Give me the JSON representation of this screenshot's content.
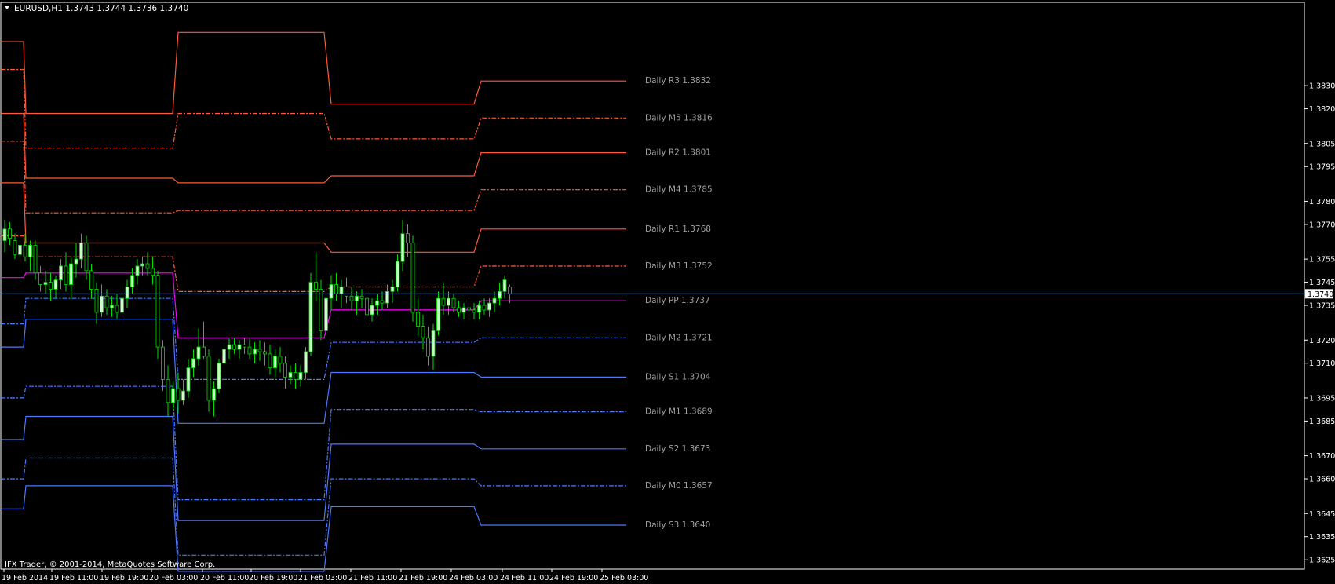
{
  "header": {
    "title": "EURUSD,H1  1.3743 1.3744 1.3736 1.3740"
  },
  "footer": {
    "copyright": "IFX Trader, © 2001-2014, MetaQuotes Software Corp."
  },
  "colors": {
    "background": "#000000",
    "frame": "#ffffff",
    "text": "#ffffff",
    "pivot_label": "#a0a0a0",
    "resistance": "#ff5a36",
    "pivot": "#ff00ff",
    "support": "#4b78ff",
    "candle_up": "#ccffcc",
    "candle_down": "#000000",
    "candle_wick": "#00e000",
    "current_price_line": "#7fa6c6"
  },
  "chart_data": {
    "type": "candlestick",
    "symbol": "EURUSD",
    "timeframe": "H1",
    "last_bar": {
      "open": 1.3743,
      "high": 1.3744,
      "low": 1.3736,
      "close": 1.374
    },
    "current_price": 1.374,
    "current_price_label": "1.3740",
    "ylim": [
      1.3621,
      1.3866
    ],
    "y_ticks": [
      "1.3830",
      "1.3820",
      "1.3805",
      "1.3795",
      "1.3780",
      "1.3770",
      "1.3755",
      "1.3745",
      "1.3735",
      "1.3720",
      "1.3710",
      "1.3695",
      "1.3685",
      "1.3670",
      "1.3660",
      "1.3645",
      "1.3635",
      "1.3625"
    ],
    "x_ticks": [
      "19 Feb 2014",
      "19 Feb 11:00",
      "19 Feb 19:00",
      "20 Feb 03:00",
      "20 Feb 11:00",
      "20 Feb 19:00",
      "21 Feb 03:00",
      "21 Feb 11:00",
      "21 Feb 19:00",
      "24 Feb 03:00",
      "24 Feb 11:00",
      "24 Feb 19:00",
      "25 Feb 03:00"
    ],
    "pivot_labels": [
      {
        "label": "Daily R3 1.3832",
        "level": 1.3832,
        "kind": "R"
      },
      {
        "label": "Daily M5 1.3816",
        "level": 1.3816,
        "kind": "M"
      },
      {
        "label": "Daily R2 1.3801",
        "level": 1.3801,
        "kind": "R"
      },
      {
        "label": "Daily M4 1.3785",
        "level": 1.3785,
        "kind": "M"
      },
      {
        "label": "Daily R1 1.3768",
        "level": 1.3768,
        "kind": "R"
      },
      {
        "label": "Daily M3 1.3752",
        "level": 1.3752,
        "kind": "M"
      },
      {
        "label": "Daily PP 1.3737",
        "level": 1.3737,
        "kind": "P"
      },
      {
        "label": "Daily M2 1.3721",
        "level": 1.3721,
        "kind": "M"
      },
      {
        "label": "Daily S1 1.3704",
        "level": 1.3704,
        "kind": "S"
      },
      {
        "label": "Daily M1 1.3689",
        "level": 1.3689,
        "kind": "M"
      },
      {
        "label": "Daily S2 1.3673",
        "level": 1.3673,
        "kind": "S"
      },
      {
        "label": "Daily M0 1.3657",
        "level": 1.3657,
        "kind": "M"
      },
      {
        "label": "Daily S3 1.3640",
        "level": 1.364,
        "kind": "S"
      }
    ],
    "daily_pivot_history": [
      {
        "R3": 1.3849,
        "M5": 1.3837,
        "R2": 1.3818,
        "M4": 1.3806,
        "R1": 1.3788,
        "M3": 1.3765,
        "PP": 1.3747,
        "M2": 1.3727,
        "S1": 1.3717,
        "M1": 1.3695,
        "S2": 1.3677,
        "M0": 1.366,
        "S3": 1.3647
      },
      {
        "R3": 1.3818,
        "M5": 1.3803,
        "R2": 1.379,
        "M4": 1.3775,
        "R1": 1.3762,
        "M3": 1.3756,
        "PP": 1.3749,
        "M2": 1.3738,
        "S1": 1.3729,
        "M1": 1.37,
        "S2": 1.3687,
        "M0": 1.3669,
        "S3": 1.3657
      },
      {
        "R3": 1.3853,
        "M5": 1.3818,
        "R2": 1.3788,
        "M4": 1.3776,
        "R1": 1.3762,
        "M3": 1.3741,
        "PP": 1.3721,
        "M2": 1.3703,
        "S1": 1.3684,
        "M1": 1.3651,
        "S2": 1.3642,
        "M0": 1.3627,
        "S3": 1.362
      },
      {
        "R3": 1.3822,
        "M5": 1.3807,
        "R2": 1.3791,
        "M4": 1.3776,
        "R1": 1.3758,
        "M3": 1.3743,
        "PP": 1.3733,
        "M2": 1.3719,
        "S1": 1.3706,
        "M1": 1.369,
        "S2": 1.3675,
        "M0": 1.366,
        "S3": 1.3648
      },
      {
        "R3": 1.3832,
        "M5": 1.3816,
        "R2": 1.3801,
        "M4": 1.3785,
        "R1": 1.3768,
        "M3": 1.3752,
        "PP": 1.3737,
        "M2": 1.3721,
        "S1": 1.3704,
        "M1": 1.3689,
        "S2": 1.3673,
        "M0": 1.3657,
        "S3": 1.364
      }
    ],
    "candles": [
      [
        1.3763,
        1.3772,
        1.3758,
        1.3768
      ],
      [
        1.3768,
        1.3771,
        1.3761,
        1.3764
      ],
      [
        1.3763,
        1.3766,
        1.3755,
        1.3757
      ],
      [
        1.3757,
        1.3763,
        1.3749,
        1.3761
      ],
      [
        1.3761,
        1.3766,
        1.3754,
        1.3756
      ],
      [
        1.3756,
        1.3763,
        1.375,
        1.3761
      ],
      [
        1.3761,
        1.3763,
        1.3746,
        1.3749
      ],
      [
        1.3749,
        1.3752,
        1.3741,
        1.3744
      ],
      [
        1.3744,
        1.375,
        1.374,
        1.3745
      ],
      [
        1.3745,
        1.3749,
        1.3737,
        1.3742
      ],
      [
        1.3742,
        1.3748,
        1.3738,
        1.3746
      ],
      [
        1.3746,
        1.3755,
        1.3742,
        1.3752
      ],
      [
        1.3752,
        1.3758,
        1.3741,
        1.3744
      ],
      [
        1.3744,
        1.3756,
        1.3738,
        1.3753
      ],
      [
        1.3753,
        1.3762,
        1.3747,
        1.3755
      ],
      [
        1.3755,
        1.3766,
        1.3751,
        1.3762
      ],
      [
        1.3762,
        1.3765,
        1.3746,
        1.375
      ],
      [
        1.375,
        1.3753,
        1.3738,
        1.3742
      ],
      [
        1.3742,
        1.3745,
        1.3727,
        1.3732
      ],
      [
        1.3732,
        1.3744,
        1.373,
        1.3739
      ],
      [
        1.3739,
        1.3742,
        1.3731,
        1.3734
      ],
      [
        1.3734,
        1.3739,
        1.373,
        1.3735
      ],
      [
        1.3735,
        1.374,
        1.3729,
        1.3732
      ],
      [
        1.3732,
        1.374,
        1.373,
        1.3738
      ],
      [
        1.3738,
        1.3746,
        1.3734,
        1.3743
      ],
      [
        1.3743,
        1.3751,
        1.374,
        1.3748
      ],
      [
        1.3748,
        1.3755,
        1.3744,
        1.3752
      ],
      [
        1.3752,
        1.3756,
        1.3748,
        1.3753
      ],
      [
        1.3753,
        1.3758,
        1.3748,
        1.3751
      ],
      [
        1.3751,
        1.3756,
        1.3744,
        1.3748
      ],
      [
        1.3748,
        1.375,
        1.3712,
        1.3717
      ],
      [
        1.3717,
        1.372,
        1.3698,
        1.3703
      ],
      [
        1.3703,
        1.3709,
        1.3687,
        1.3693
      ],
      [
        1.3693,
        1.3702,
        1.369,
        1.3699
      ],
      [
        1.3699,
        1.3706,
        1.3688,
        1.3694
      ],
      [
        1.3694,
        1.3703,
        1.3692,
        1.3698
      ],
      [
        1.3698,
        1.3712,
        1.3695,
        1.3708
      ],
      [
        1.3708,
        1.3716,
        1.3704,
        1.3712
      ],
      [
        1.3712,
        1.3725,
        1.3709,
        1.3717
      ],
      [
        1.3717,
        1.3728,
        1.3712,
        1.3713
      ],
      [
        1.3713,
        1.3716,
        1.3689,
        1.3694
      ],
      [
        1.3694,
        1.3702,
        1.3687,
        1.3699
      ],
      [
        1.3699,
        1.3712,
        1.3697,
        1.371
      ],
      [
        1.371,
        1.3719,
        1.3706,
        1.3716
      ],
      [
        1.3716,
        1.3721,
        1.3712,
        1.3718
      ],
      [
        1.3718,
        1.3721,
        1.3714,
        1.3716
      ],
      [
        1.3716,
        1.372,
        1.3712,
        1.3718
      ],
      [
        1.3718,
        1.3721,
        1.3714,
        1.3717
      ],
      [
        1.3717,
        1.3721,
        1.3712,
        1.3714
      ],
      [
        1.3714,
        1.3719,
        1.371,
        1.3716
      ],
      [
        1.3716,
        1.372,
        1.3711,
        1.3715
      ],
      [
        1.3715,
        1.3719,
        1.3709,
        1.3714
      ],
      [
        1.3714,
        1.3718,
        1.3705,
        1.3708
      ],
      [
        1.3708,
        1.3716,
        1.3704,
        1.3713
      ],
      [
        1.3713,
        1.3717,
        1.3706,
        1.371
      ],
      [
        1.371,
        1.3713,
        1.3699,
        1.3704
      ],
      [
        1.3704,
        1.3709,
        1.3701,
        1.3706
      ],
      [
        1.3706,
        1.371,
        1.3699,
        1.3703
      ],
      [
        1.3703,
        1.3709,
        1.37,
        1.3706
      ],
      [
        1.3706,
        1.3717,
        1.3703,
        1.3715
      ],
      [
        1.3715,
        1.3749,
        1.3713,
        1.3745
      ],
      [
        1.3745,
        1.3758,
        1.3737,
        1.3742
      ],
      [
        1.3742,
        1.3746,
        1.372,
        1.3724
      ],
      [
        1.3724,
        1.3741,
        1.3721,
        1.3738
      ],
      [
        1.3738,
        1.3748,
        1.3733,
        1.3744
      ],
      [
        1.3744,
        1.3749,
        1.3737,
        1.374
      ],
      [
        1.374,
        1.3746,
        1.3734,
        1.3743
      ],
      [
        1.3743,
        1.3747,
        1.3736,
        1.3739
      ],
      [
        1.3739,
        1.3743,
        1.3733,
        1.3737
      ],
      [
        1.3737,
        1.3741,
        1.3731,
        1.3739
      ],
      [
        1.3739,
        1.3742,
        1.3734,
        1.3738
      ],
      [
        1.3738,
        1.3741,
        1.3727,
        1.3731
      ],
      [
        1.3731,
        1.3738,
        1.3728,
        1.3735
      ],
      [
        1.3735,
        1.374,
        1.3731,
        1.3737
      ],
      [
        1.3737,
        1.3741,
        1.3733,
        1.3736
      ],
      [
        1.3736,
        1.3744,
        1.3734,
        1.3741
      ],
      [
        1.3741,
        1.3746,
        1.3736,
        1.3743
      ],
      [
        1.3743,
        1.3757,
        1.3741,
        1.3754
      ],
      [
        1.3754,
        1.3772,
        1.375,
        1.3766
      ],
      [
        1.3766,
        1.377,
        1.3756,
        1.3762
      ],
      [
        1.3762,
        1.3765,
        1.3728,
        1.3732
      ],
      [
        1.3732,
        1.3738,
        1.3722,
        1.3726
      ],
      [
        1.3726,
        1.3731,
        1.3716,
        1.3721
      ],
      [
        1.3721,
        1.3726,
        1.3709,
        1.3713
      ],
      [
        1.3713,
        1.3727,
        1.3707,
        1.3724
      ],
      [
        1.3724,
        1.3741,
        1.3722,
        1.3738
      ],
      [
        1.3738,
        1.3745,
        1.3731,
        1.3735
      ],
      [
        1.3735,
        1.3741,
        1.3731,
        1.3738
      ],
      [
        1.3738,
        1.374,
        1.3732,
        1.3734
      ],
      [
        1.3734,
        1.3737,
        1.373,
        1.3732
      ],
      [
        1.3732,
        1.3736,
        1.3729,
        1.3734
      ],
      [
        1.3734,
        1.3737,
        1.373,
        1.3733
      ],
      [
        1.3733,
        1.3736,
        1.3729,
        1.3732
      ],
      [
        1.3732,
        1.3737,
        1.3729,
        1.3735
      ],
      [
        1.3735,
        1.3738,
        1.3731,
        1.3733
      ],
      [
        1.3733,
        1.3738,
        1.373,
        1.3736
      ],
      [
        1.3736,
        1.3741,
        1.3732,
        1.3738
      ],
      [
        1.3738,
        1.3745,
        1.3735,
        1.3741
      ],
      [
        1.3741,
        1.3748,
        1.3738,
        1.3746
      ],
      [
        1.3743,
        1.3744,
        1.3736,
        1.374
      ]
    ]
  }
}
